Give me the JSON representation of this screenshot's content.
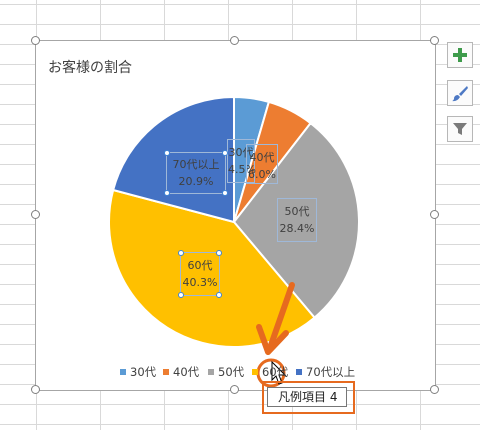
{
  "chart": {
    "title": "お客様の割合"
  },
  "chart_data": {
    "type": "pie",
    "categories": [
      "30代",
      "40代",
      "50代",
      "60代",
      "70代以上"
    ],
    "values": [
      4.5,
      6.0,
      28.4,
      40.3,
      20.9
    ],
    "data_labels": [
      "4.5%",
      "6.0%",
      "28.4%",
      "40.3%",
      "20.9%"
    ],
    "colors": [
      "#5b9bd5",
      "#ed7d31",
      "#a5a5a5",
      "#ffc000",
      "#4472c4"
    ],
    "legend_position": "bottom"
  },
  "legend": {
    "items": [
      {
        "label": "30代",
        "color": "#5b9bd5"
      },
      {
        "label": "40代",
        "color": "#ed7d31"
      },
      {
        "label": "50代",
        "color": "#a5a5a5"
      },
      {
        "label": "60代",
        "color": "#ffc000"
      },
      {
        "label": "70代以上",
        "color": "#4472c4"
      }
    ]
  },
  "side_buttons": {
    "elements": "chart-elements-plus-icon",
    "styles": "chart-styles-brush-icon",
    "filters": "chart-filters-funnel-icon"
  },
  "tooltip": {
    "text": "凡例項目 4"
  },
  "annotation_color": "#e66a1f"
}
